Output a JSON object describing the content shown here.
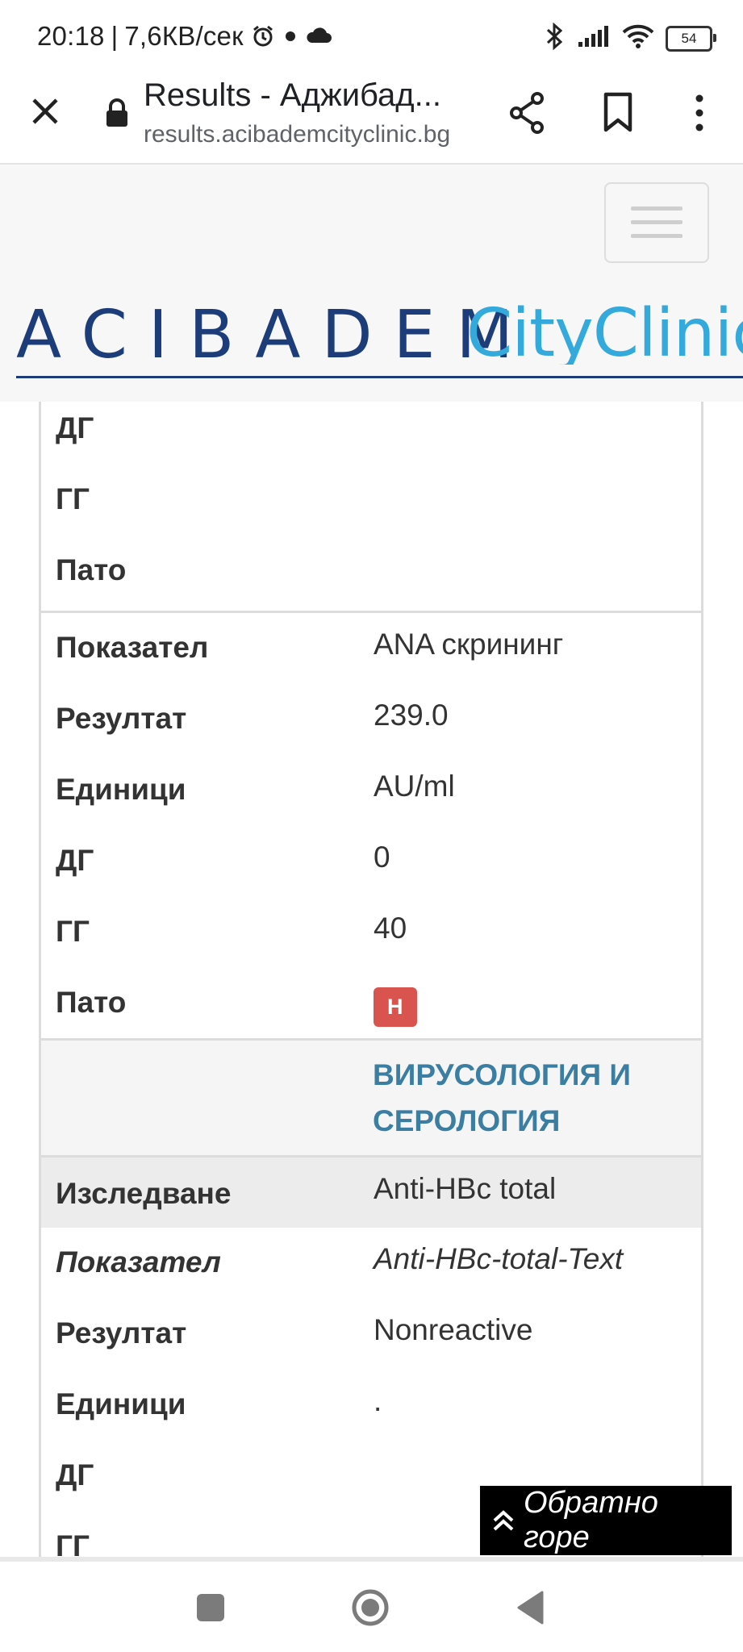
{
  "status_bar": {
    "time": "20:18",
    "speed": "7,6КВ/сек",
    "battery": "54"
  },
  "browser": {
    "title": "Results - Аджибад...",
    "url": "results.acibademcityclinic.bg"
  },
  "site": {
    "brand_left": "ACIBADEM",
    "brand_right": "CityClinic"
  },
  "block_top": {
    "rows": [
      {
        "label": "ДГ",
        "value": ""
      },
      {
        "label": "ГГ",
        "value": ""
      },
      {
        "label": "Пато",
        "value": ""
      }
    ]
  },
  "block_ana": {
    "rows": [
      {
        "label": "Показател",
        "value": "ANA скрининг"
      },
      {
        "label": "Резултат",
        "value": "239.0"
      },
      {
        "label": "Единици",
        "value": "AU/ml"
      },
      {
        "label": "ДГ",
        "value": "0"
      },
      {
        "label": "ГГ",
        "value": "40"
      },
      {
        "label": "Пато",
        "badge": "H"
      }
    ]
  },
  "section_virology": {
    "title": "ВИРУСОЛОГИЯ И СЕРОЛОГИЯ"
  },
  "block_hbc": {
    "rows": [
      {
        "label": "Изследване",
        "value": "Anti-HBc total"
      },
      {
        "label": "Показател",
        "value": "Anti-HBc-total-Text"
      },
      {
        "label": "Резултат",
        "value": "Nonreactive"
      },
      {
        "label": "Единици",
        "value": "."
      },
      {
        "label": "ДГ",
        "value": ""
      },
      {
        "label": "ГГ",
        "value": ""
      }
    ]
  },
  "back_to_top": {
    "label": "Обратно горе"
  },
  "colors": {
    "badge_red": "#d9534f",
    "section_blue": "#3b7ea1",
    "brand_navy": "#1c3d7a",
    "brand_cyan": "#34a9dc"
  }
}
